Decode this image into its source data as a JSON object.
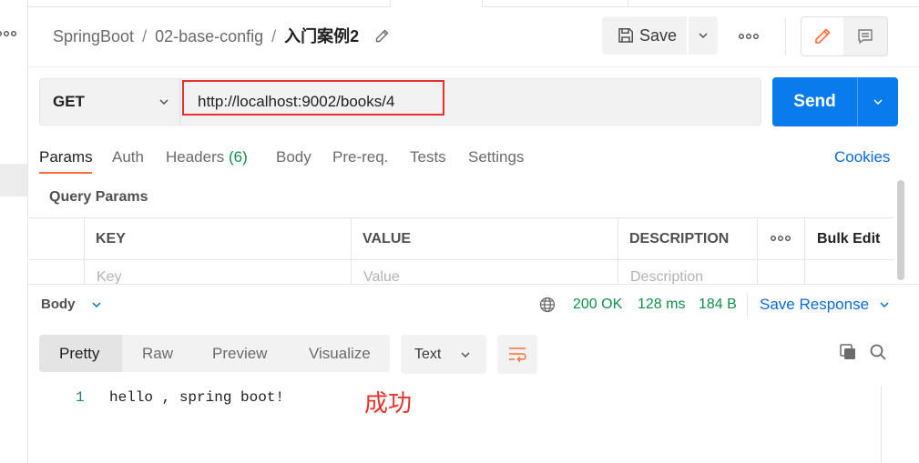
{
  "sidebar": {
    "more_icon": "more-horizontal-icon"
  },
  "breadcrumb": {
    "items": [
      "SpringBoot",
      "02-base-config",
      "入门案例2"
    ],
    "separator": "/",
    "edit_icon": "pencil-icon"
  },
  "toolbar": {
    "save_label": "Save",
    "save_icon": "save-icon",
    "save_menu_icon": "chevron-down-icon",
    "more_icon": "more-horizontal-icon",
    "mode_edit_icon": "pencil-icon",
    "mode_comment_icon": "comment-icon"
  },
  "request": {
    "method": "GET",
    "method_icon": "chevron-down-icon",
    "url": "http://localhost:9002/books/4",
    "send_label": "Send",
    "send_menu_icon": "chevron-down-icon"
  },
  "request_tabs": {
    "items": [
      {
        "label": "Params",
        "active": true
      },
      {
        "label": "Auth"
      },
      {
        "label": "Headers",
        "count": "(6)"
      },
      {
        "label": "Body"
      },
      {
        "label": "Pre-req."
      },
      {
        "label": "Tests"
      },
      {
        "label": "Settings"
      }
    ],
    "cookies_label": "Cookies"
  },
  "params": {
    "title": "Query Params",
    "columns": {
      "key": "KEY",
      "value": "VALUE",
      "description": "DESCRIPTION",
      "bulk_edit": "Bulk Edit"
    },
    "more_icon": "more-horizontal-icon",
    "placeholders": {
      "key": "Key",
      "value": "Value",
      "description": "Description"
    }
  },
  "response": {
    "section_label": "Body",
    "status": "200 OK",
    "time": "128 ms",
    "size": "184 B",
    "save_label": "Save Response",
    "network_icon": "globe-icon",
    "view_tabs": [
      {
        "label": "Pretty",
        "active": true
      },
      {
        "label": "Raw"
      },
      {
        "label": "Preview"
      },
      {
        "label": "Visualize"
      }
    ],
    "format": "Text",
    "wrap_icon": "wrap-lines-icon",
    "copy_icon": "copy-icon",
    "search_icon": "search-icon",
    "lines": [
      {
        "number": "1",
        "text": "hello , spring boot!"
      }
    ]
  },
  "annotation": {
    "text": "成功"
  },
  "colors": {
    "accent": "#FF6C37",
    "primary": "#097BED",
    "link": "#0A6BD7",
    "success": "#0F8F48",
    "annotation": "#E5322D"
  }
}
